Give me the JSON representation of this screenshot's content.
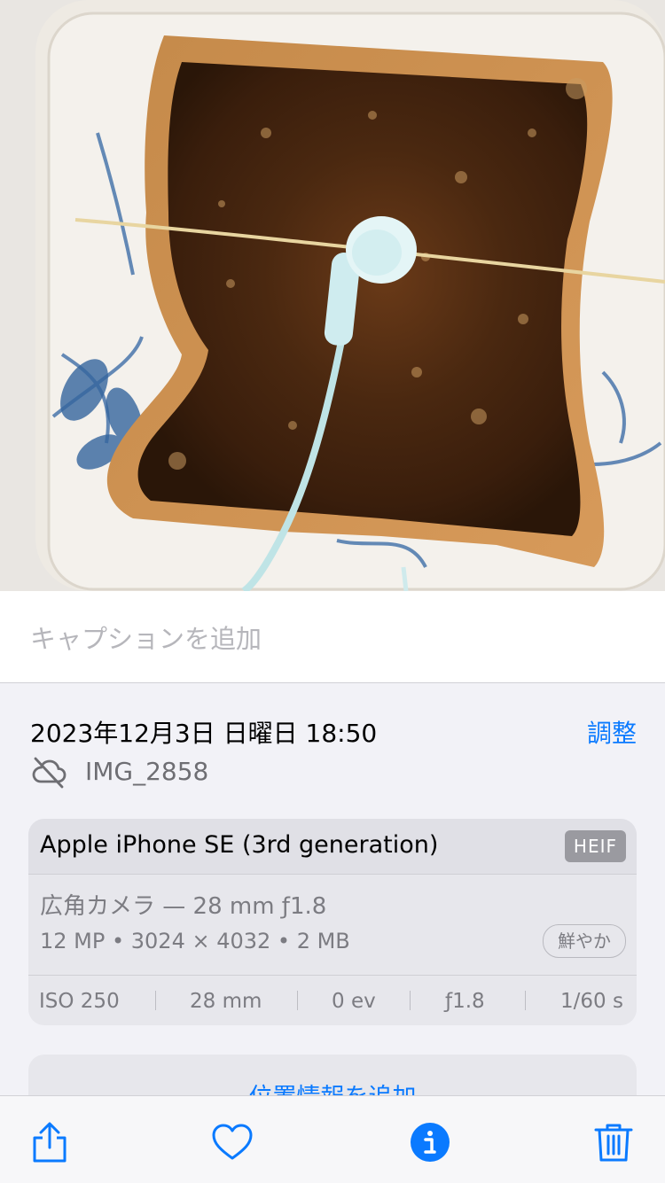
{
  "caption": {
    "placeholder": "キャプションを追加"
  },
  "info": {
    "datetime": "2023年12月3日 日曜日 18:50",
    "adjust_label": "調整",
    "filename": "IMG_2858",
    "cloud_icon": "icloud-slash-icon"
  },
  "camera": {
    "device": "Apple iPhone SE (3rd generation)",
    "format_badge": "HEIF",
    "lens": "広角カメラ — 28 mm ƒ1.8",
    "specs": "12 MP • 3024 × 4032 • 2 MB",
    "style": "鮮やか",
    "exif": {
      "iso": "ISO 250",
      "focal": "28 mm",
      "ev": "0 ev",
      "aperture": "ƒ1.8",
      "shutter": "1/60 s"
    }
  },
  "location": {
    "add_label": "位置情報を追加"
  },
  "toolbar": {
    "share_icon": "share-icon",
    "favorite_icon": "heart-icon",
    "info_icon": "info-icon",
    "delete_icon": "trash-icon"
  },
  "colors": {
    "accent": "#0a7aff",
    "background": "#f2f2f7"
  }
}
